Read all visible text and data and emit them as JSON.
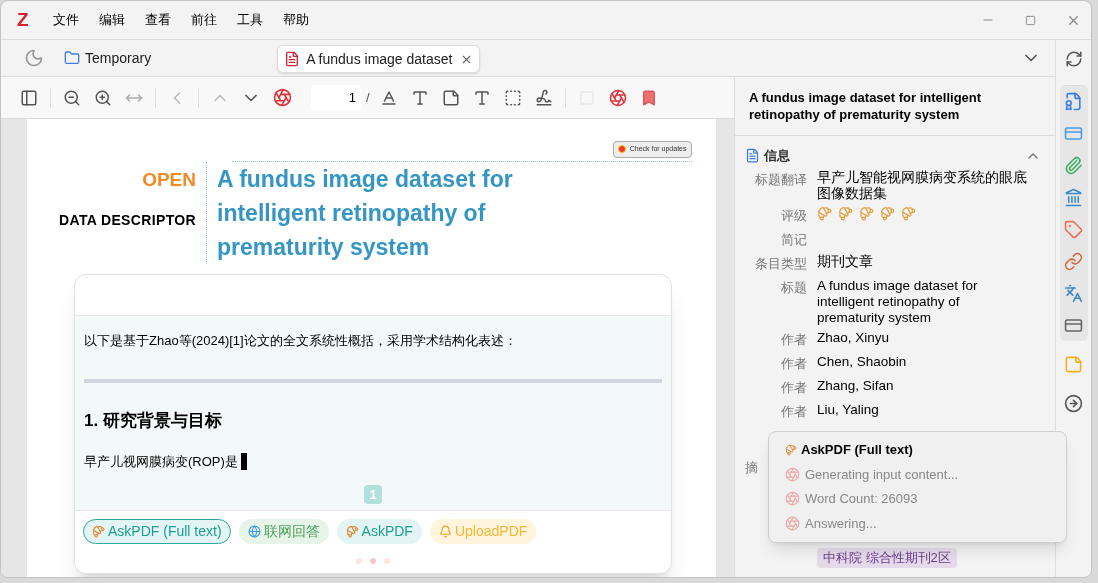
{
  "menu": {
    "logo": "Z",
    "items": [
      "文件",
      "编辑",
      "查看",
      "前往",
      "工具",
      "帮助"
    ]
  },
  "tabs": [
    {
      "label": "Temporary",
      "kind": "library",
      "selected": false
    },
    {
      "label": "A fundus image dataset",
      "kind": "pdf",
      "selected": true
    }
  ],
  "toolbar": {
    "page": "1",
    "page_sep": "/"
  },
  "pdf": {
    "update_button": "Check for updates",
    "badge": "OPEN",
    "section": "DATA DESCRIPTOR",
    "title": "A fundus image dataset for intelligent retinopathy of prematurity system"
  },
  "chat": {
    "intro": "以下是基于Zhao等(2024)[1]论文的全文系统性概括，采用学术结构化表述：",
    "heading": "1. 研究背景与目标",
    "answer": "早产儿视网膜病变(ROP)是",
    "page_badge": "1",
    "actions": [
      {
        "label": "AskPDF (Full text)",
        "kind": "askfull",
        "selected": true
      },
      {
        "label": "联网回答",
        "kind": "web",
        "selected": false
      },
      {
        "label": "AskPDF",
        "kind": "ask",
        "selected": false
      },
      {
        "label": "UploadPDF",
        "kind": "upload",
        "selected": false
      }
    ],
    "dots": [
      {
        "selected": false
      },
      {
        "selected": true
      },
      {
        "selected": false
      }
    ]
  },
  "item_pane": {
    "title": "A fundus image dataset for intelligent retinopathy of prematurity system",
    "section": "信息",
    "fields": [
      {
        "kind": "text",
        "label": "标题翻译",
        "value": "早产儿智能视网膜病变系统的眼底图像数据集"
      },
      {
        "kind": "rating",
        "label": "评级",
        "stars": 5
      },
      {
        "kind": "text",
        "label": "简记"
      },
      {
        "kind": "text",
        "label": "条目类型",
        "value": "期刊文章"
      },
      {
        "kind": "text",
        "label": "标题",
        "value": "A fundus image dataset for intelligent retinopathy of prematurity system"
      },
      {
        "kind": "text",
        "label": "作者",
        "value": "Zhao, Xinyu"
      },
      {
        "kind": "text",
        "label": "作者",
        "value": "Chen, Shaobin"
      },
      {
        "kind": "text",
        "label": "作者",
        "value": "Zhang, Sifan"
      },
      {
        "kind": "text",
        "label": "作者",
        "value": "Liu, Yaling"
      },
      {
        "kind": "heading",
        "label": "摘"
      },
      {
        "kind": "tag",
        "value": "中科院 综合性期刊2区"
      }
    ]
  },
  "status_popup": {
    "title": "AskPDF (Full text)",
    "lines": [
      "Generating input content...",
      "Word Count: 26093",
      "Answering..."
    ]
  }
}
